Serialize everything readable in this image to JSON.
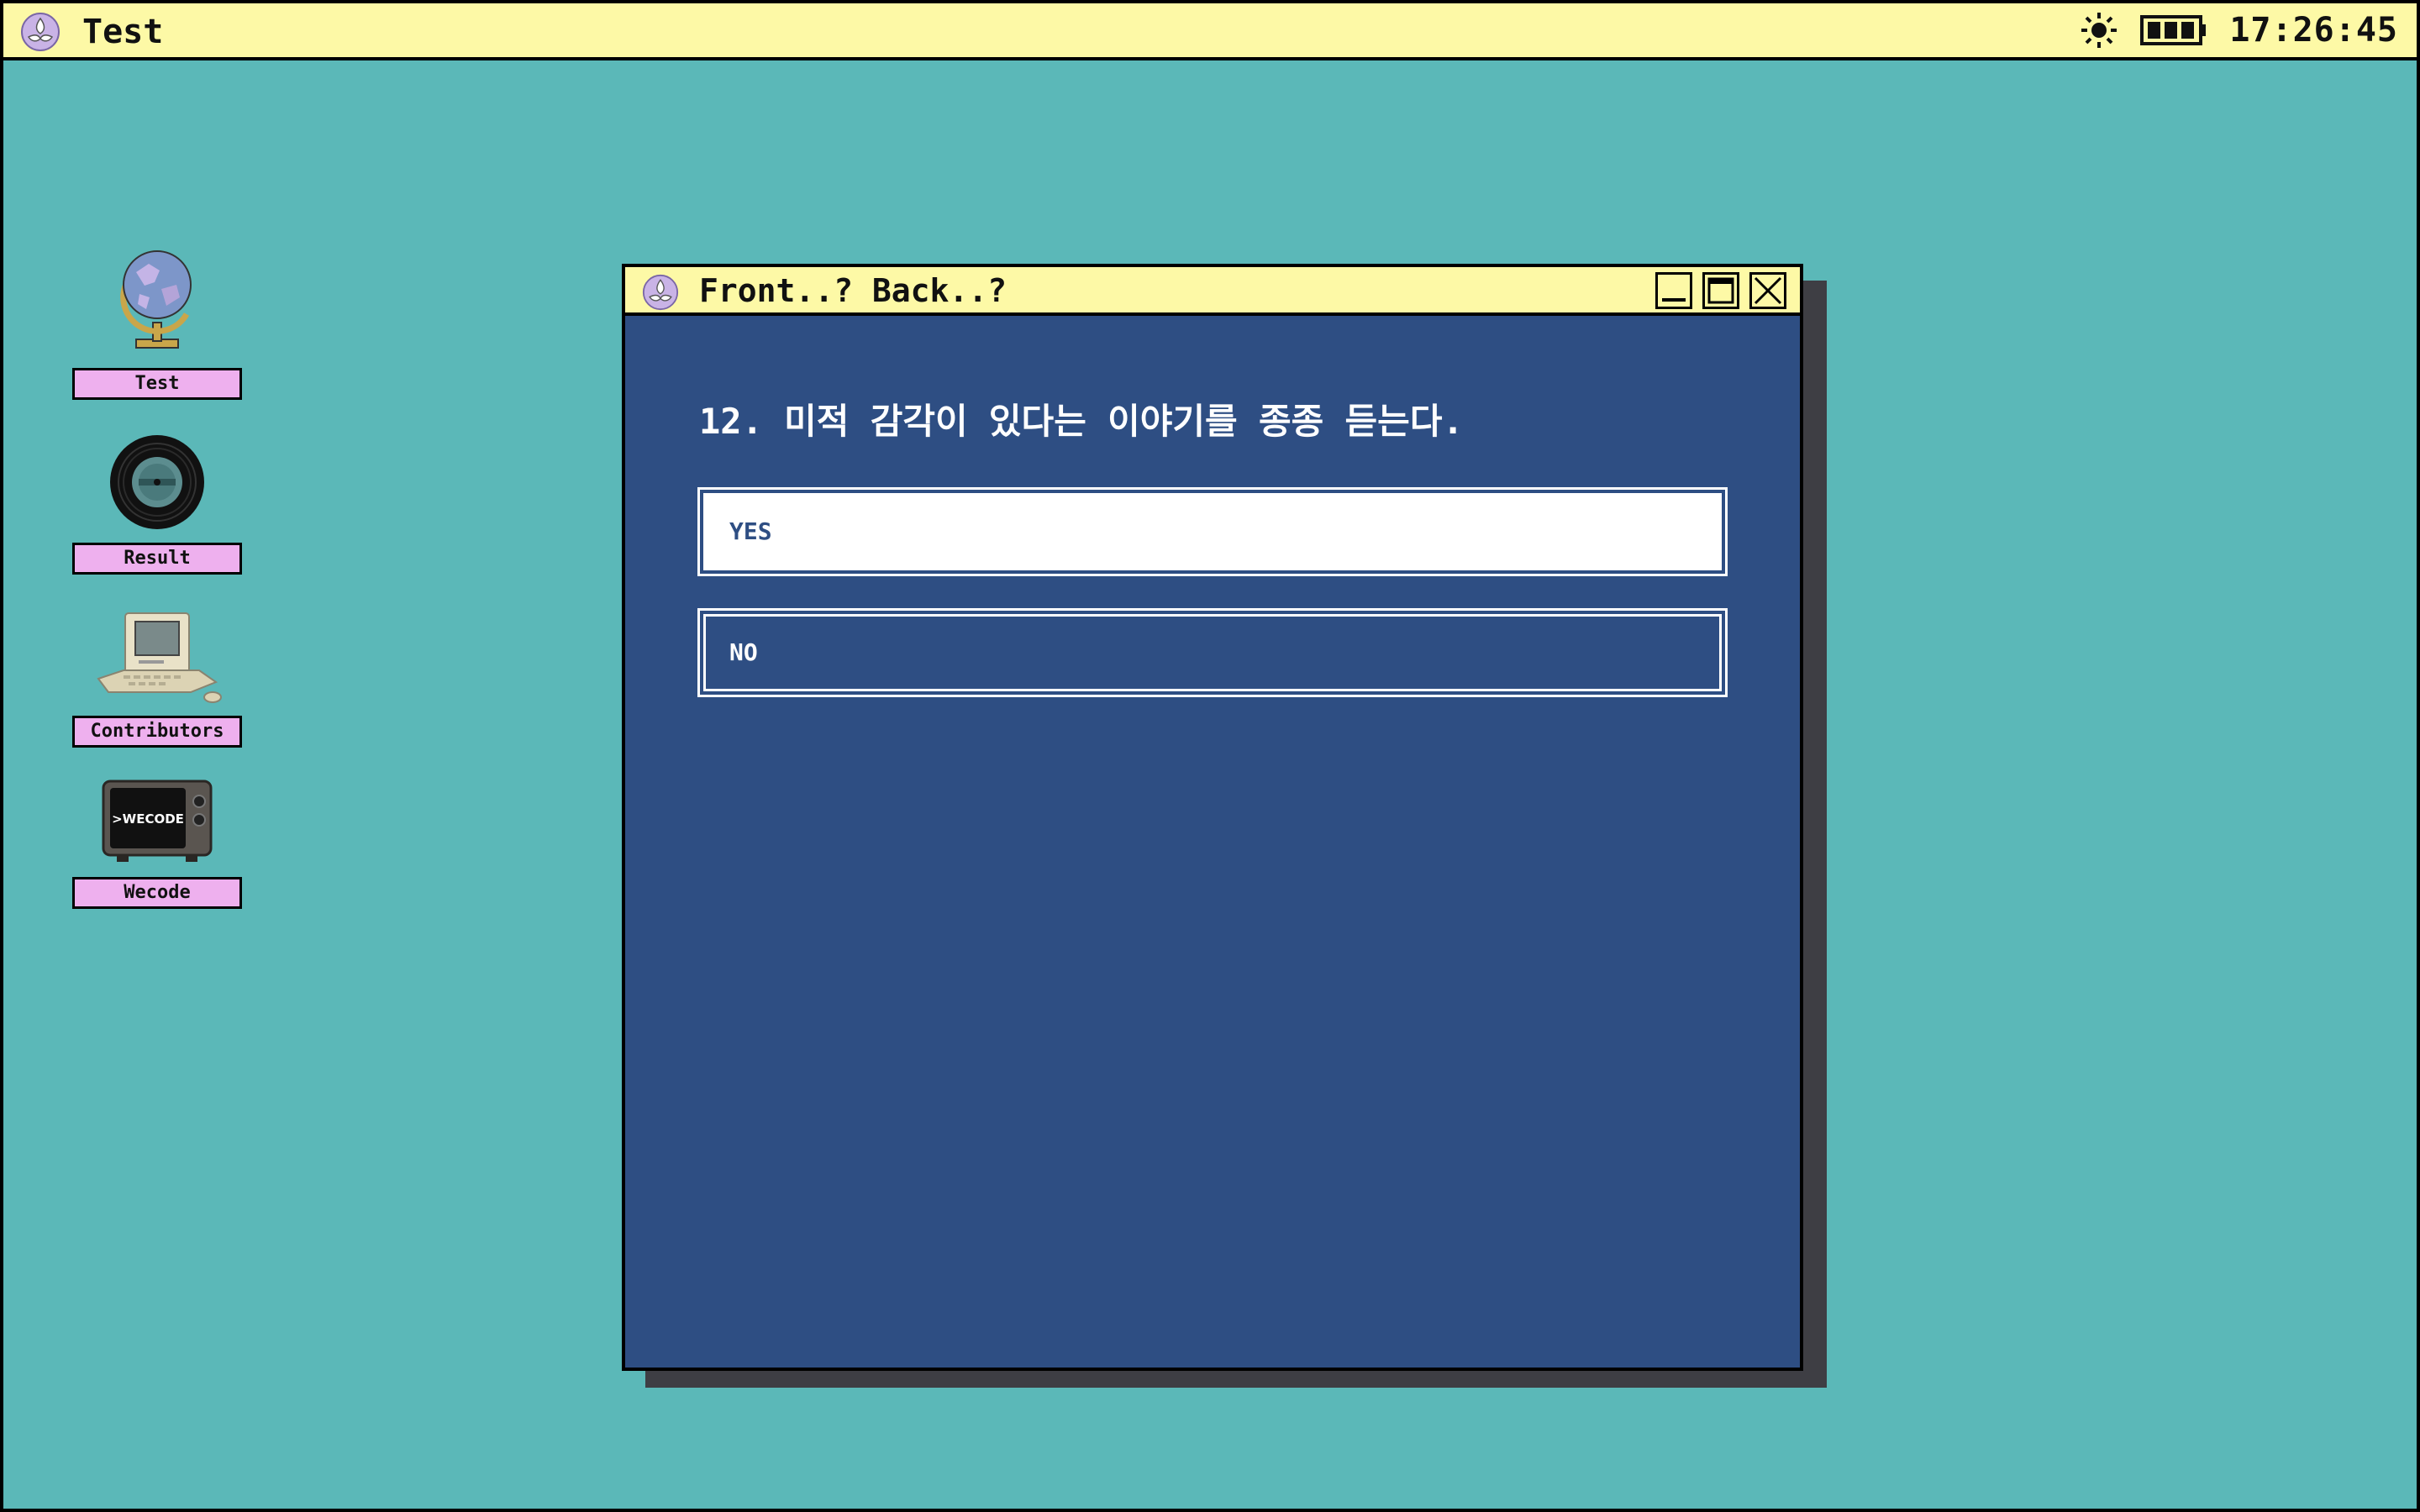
{
  "menubar": {
    "app_title": "Test",
    "clock": "17:26:45",
    "icons": [
      "flower-logo-icon",
      "brightness-icon",
      "battery-icon"
    ]
  },
  "desktop": {
    "icons": [
      {
        "label": "Test",
        "icon": "globe-icon"
      },
      {
        "label": "Result",
        "icon": "vinyl-record-icon"
      },
      {
        "label": "Contributors",
        "icon": "retro-computer-icon"
      },
      {
        "label": "Wecode",
        "icon": "retro-tv-icon",
        "screen_text": ">WECODE"
      }
    ]
  },
  "window": {
    "title": "Front..? Back..?",
    "question": "12. 미적 감각이 있다는 이야기를 종종 듣는다.",
    "answers": [
      {
        "label": "YES",
        "selected": true
      },
      {
        "label": "NO",
        "selected": false
      }
    ]
  },
  "colors": {
    "desktop_bg": "#5bb8b8",
    "menubar_bg": "#fdf9a6",
    "window_bg": "#2e4e83",
    "icon_label_bg": "#eeb0ee",
    "window_shadow": "#3e3e44"
  }
}
